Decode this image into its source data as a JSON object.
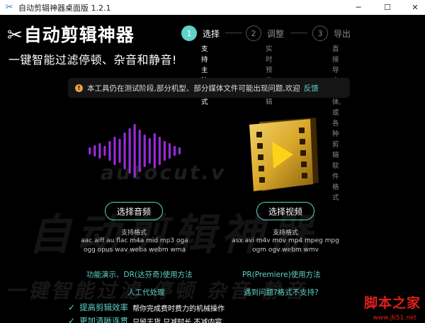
{
  "window": {
    "title": "自动剪辑神器桌面版 1.2.1",
    "minimize": "─",
    "maximize": "☐",
    "close": "✕"
  },
  "logo": {
    "name": "自动剪辑神器",
    "slogan": "一键智能过滤停顿、杂音和静音!"
  },
  "steps": [
    {
      "number": "1",
      "label": "选择",
      "desc_lines": [
        "支持主流视",
        "式"
      ]
    },
    {
      "number": "2",
      "label": "调整",
      "desc_lines": [
        "实时预览,",
        "编辑"
      ]
    },
    {
      "number": "3",
      "label": "导出",
      "desc_lines": [
        "直接导出媒体, 或各种",
        "剪辑软件格式"
      ]
    }
  ],
  "notice": {
    "icon": "!",
    "text": "本工具仍在测试阶段,部分机型、部分媒体文件可能出现问题,欢迎",
    "link": "反馈"
  },
  "watermarks": {
    "url": "autocut.v",
    "big": "自动剪辑神器",
    "bottom": "一键智能过滤  停顿  杂音  静音"
  },
  "audio": {
    "button": "选择音频",
    "formats_title": "支持格式",
    "formats_lines": [
      "aac aiff au flac m4a mid mp3 oga",
      "ogg opus wav weba webm wma"
    ]
  },
  "video": {
    "button": "选择视频",
    "formats_title": "支持格式",
    "formats_lines": [
      "asx avi m4v mov mp4 mpeg mpg",
      "ogm ogv webm wmv"
    ]
  },
  "links": {
    "dr": "功能演示、DR(达芬奇)使用方法",
    "manual": "人工代处理",
    "pr": "PR(Premiere)使用方法",
    "problem": "遇到问题?格式不支持?"
  },
  "features": [
    {
      "title": "提高剪辑效率",
      "desc": "帮你完成费时费力的机械操作"
    },
    {
      "title": "更加清晰连贯",
      "desc": "只留干货,只减时长,不减内容"
    }
  ],
  "corner": {
    "brand": "脚本之家",
    "url": "www.jb51.net"
  },
  "colors": {
    "accent": "#5fd3c8",
    "warning": "#e8a23a",
    "waveform_start": "#3d2fd6",
    "waveform_end": "#e021c8",
    "film_gold": "#d9a82a"
  }
}
